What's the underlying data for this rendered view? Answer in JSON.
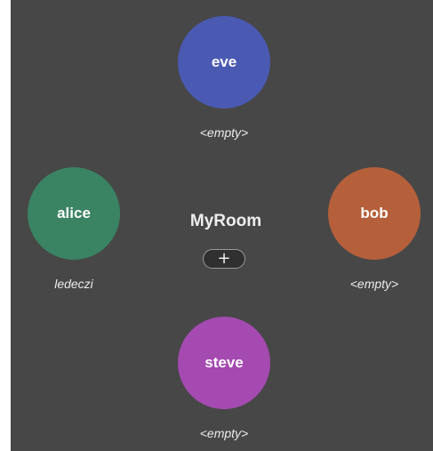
{
  "room": {
    "name": "MyRoom",
    "add_button_label": "+"
  },
  "players": [
    {
      "name": "eve",
      "status": "<empty>",
      "color": "#4a59b2"
    },
    {
      "name": "alice",
      "status": "ledeczi",
      "color": "#3a8363"
    },
    {
      "name": "bob",
      "status": "<empty>",
      "color": "#b5603b"
    },
    {
      "name": "steve",
      "status": "<empty>",
      "color": "#a44ab0"
    }
  ],
  "colors": {
    "background": "#474747",
    "text": "#ffffff"
  }
}
